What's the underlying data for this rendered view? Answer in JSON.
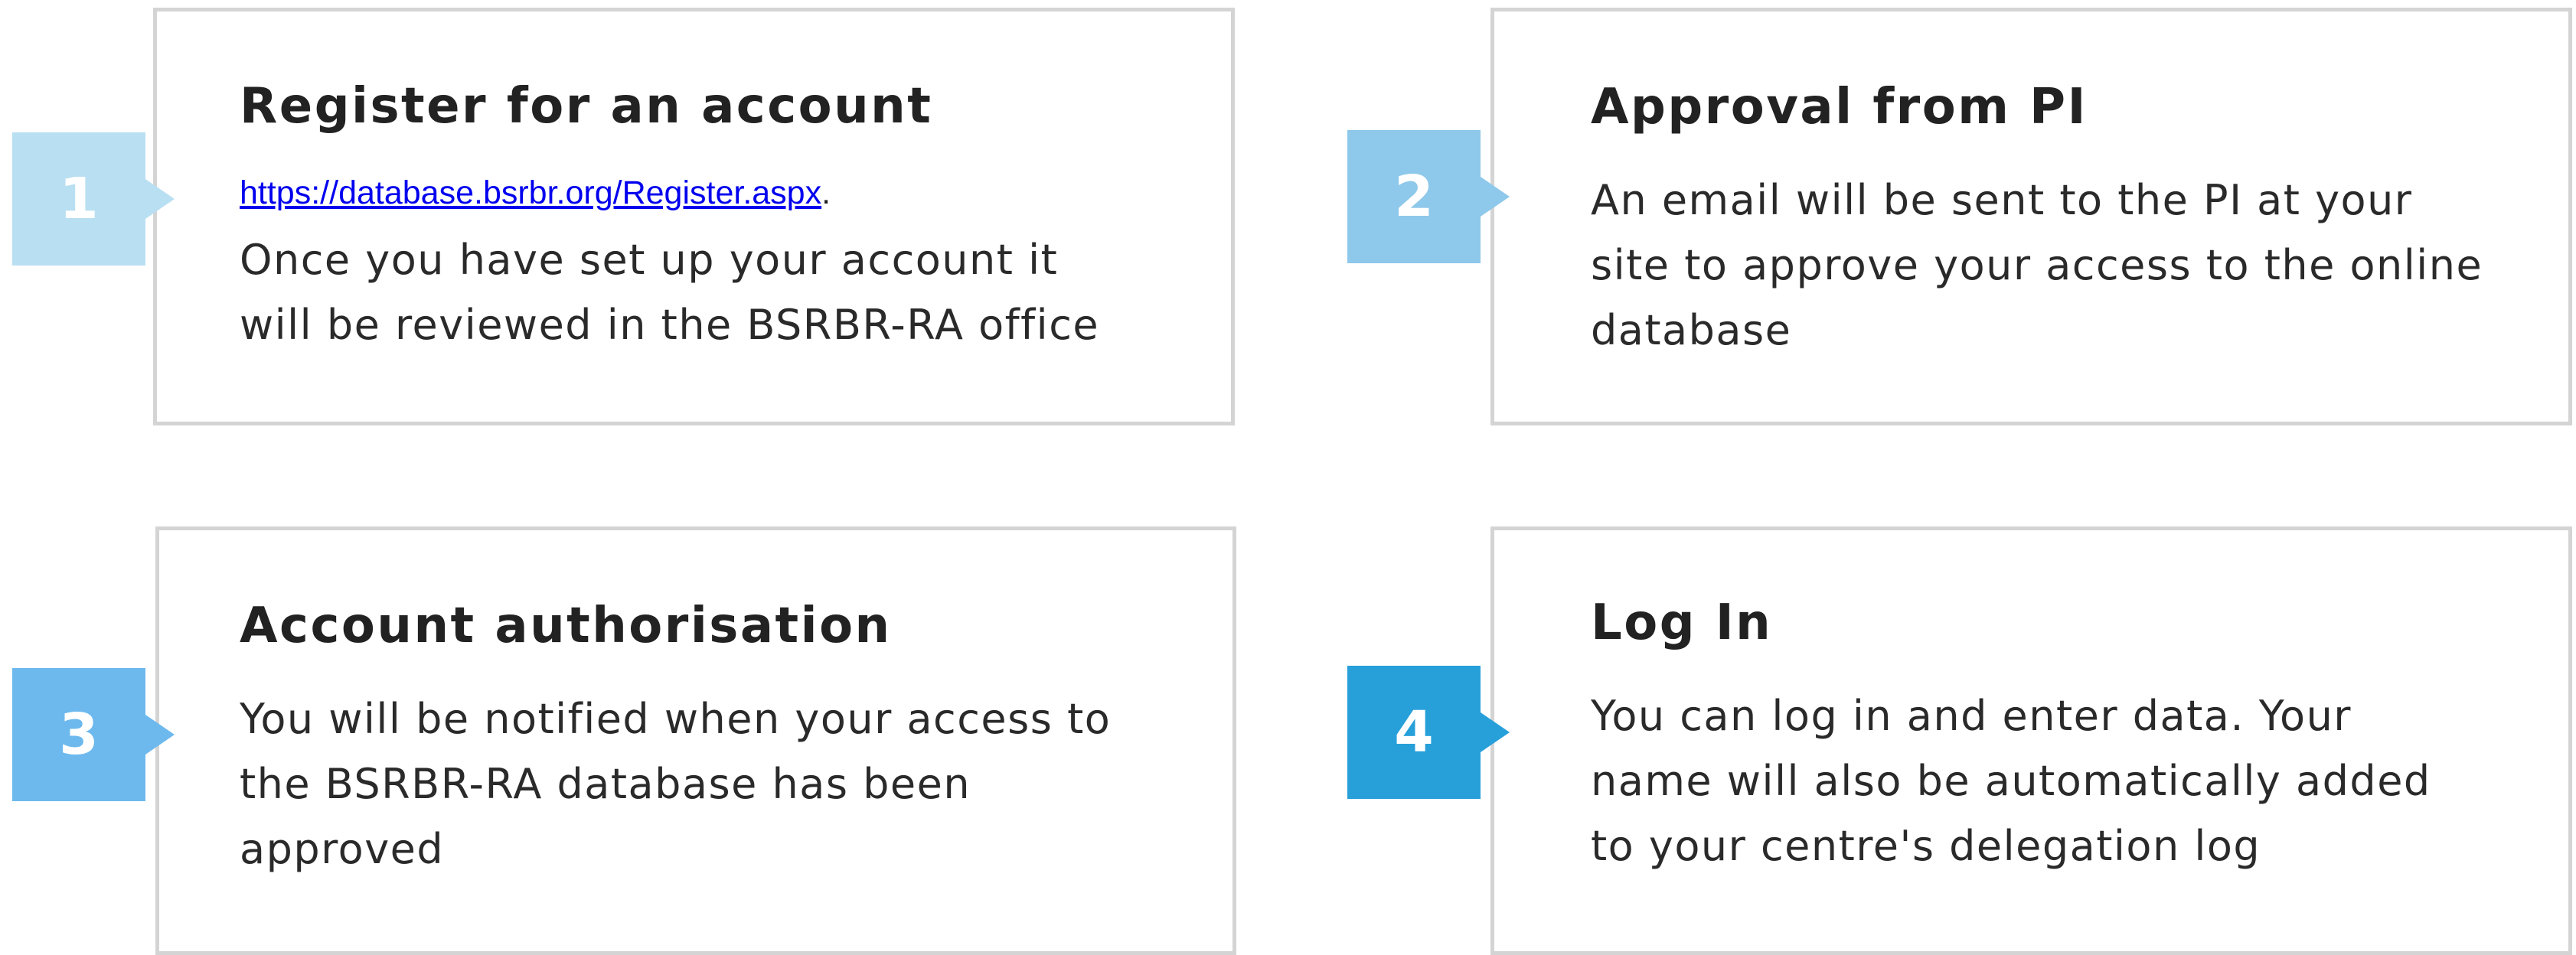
{
  "steps": [
    {
      "number": "1",
      "title": "Register for an account",
      "link_text": "https://database.bsrbr.org/Register.aspx",
      "link_suffix": ".",
      "lines": [
        "Once you have set up your account it",
        "will be reviewed in the BSRBR-RA office"
      ],
      "badge_color": "#b9dff2"
    },
    {
      "number": "2",
      "title": "Approval from PI",
      "lines": [
        "An email will be sent to the PI at your",
        "site to approve your access to the online",
        "database"
      ],
      "badge_color": "#8ec8ea"
    },
    {
      "number": "3",
      "title": "Account authorisation",
      "lines": [
        "You will be notified when your access to",
        "the BSRBR-RA database has been",
        "approved"
      ],
      "badge_color": "#6db9ee"
    },
    {
      "number": "4",
      "title": "Log In",
      "lines": [
        "You can log in and enter data. Your",
        "name will also be automatically added",
        "to your centre's delegation log"
      ],
      "badge_color": "#27a0da"
    }
  ]
}
